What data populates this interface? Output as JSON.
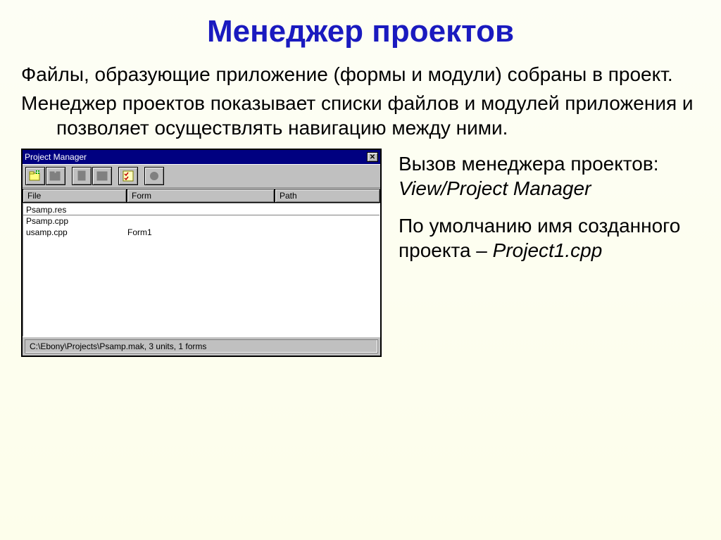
{
  "slide": {
    "title": "Менеджер проектов",
    "para1": "Файлы, образующие приложение (формы и модули) собраны в проект.",
    "para2": "Менеджер проектов показывает списки файлов и модулей приложения и позволяет осуществлять навигацию между ними."
  },
  "right": {
    "p1_a": "Вызов менеджера проектов:",
    "p1_b": "View/Project Manager",
    "p2_a": "По умолчанию имя созданного проекта – ",
    "p2_b": "Project1.cpp"
  },
  "pm": {
    "title": "Project Manager",
    "close_glyph": "✕",
    "toolbar": {
      "add": "add-file",
      "remove": "remove-file",
      "view_unit": "view-unit",
      "view_form": "view-form",
      "options": "project-options",
      "update": "update"
    },
    "headers": {
      "file": "File",
      "form": "Form",
      "path": "Path"
    },
    "rows": [
      {
        "file": "Psamp.res",
        "form": "",
        "path": ""
      },
      {
        "file": "Psamp.cpp",
        "form": "",
        "path": ""
      },
      {
        "file": "usamp.cpp",
        "form": "Form1",
        "path": ""
      }
    ],
    "status": "C:\\Ebony\\Projects\\Psamp.mak, 3 units, 1 forms"
  }
}
